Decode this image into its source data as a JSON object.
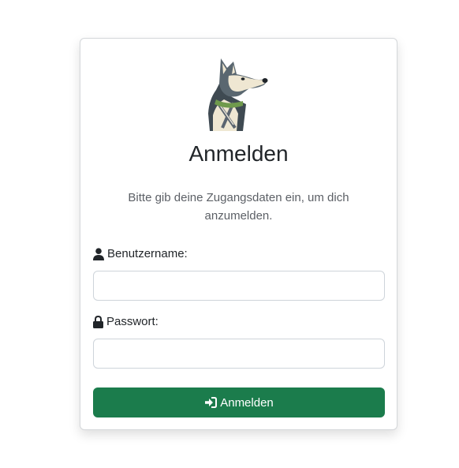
{
  "login": {
    "title": "Anmelden",
    "intro": "Bitte gib deine Zugangsdaten ein, um dich anzumelden.",
    "username": {
      "label": "Benutzername:",
      "value": "",
      "icon": "user-icon"
    },
    "password": {
      "label": "Passwort:",
      "value": "",
      "icon": "lock-icon"
    },
    "submit": {
      "label": "Anmelden",
      "icon": "sign-in-icon"
    },
    "logo": "husky-dog-logo"
  },
  "colors": {
    "primary": "#1b7c4c",
    "border": "#ced4da",
    "text": "#212529",
    "muted": "#5c6066"
  }
}
